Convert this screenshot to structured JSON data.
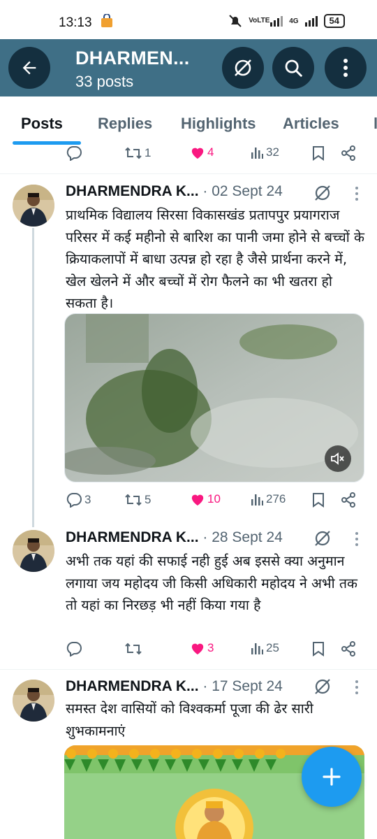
{
  "status_bar": {
    "time": "13:13",
    "network_label": "VoLTE",
    "signal_label": "4G",
    "battery": "54"
  },
  "header": {
    "title": "DHARMEN...",
    "subtitle": "33 posts"
  },
  "tabs": [
    {
      "label": "Posts",
      "active": true
    },
    {
      "label": "Replies",
      "active": false
    },
    {
      "label": "Highlights",
      "active": false
    },
    {
      "label": "Articles",
      "active": false
    }
  ],
  "top_actions": {
    "replies": "",
    "reposts": "1",
    "likes": "4",
    "views": "32"
  },
  "posts": [
    {
      "author": "DHARMENDRA K...",
      "date": "· 02 Sept 24",
      "text": "प्राथमिक विद्यालय सिरसा विकासखंड प्रतापपुर प्रयागराज परिसर में कई महीनो से बारिश का पानी जमा होने से बच्चों के क्रियाकलापों में बाधा उत्पन्न हो रहा है जैसे प्रार्थना करने में, खेल खेलने में और बच्चों में रोग फैलने का भी खतरा हो सकता है।",
      "replies": "3",
      "reposts": "5",
      "likes": "10",
      "views": "276"
    },
    {
      "author": "DHARMENDRA K...",
      "date": "· 28 Sept 24",
      "text": "अभी तक यहां की सफाई नही हुई अब इससे क्या अनुमान लगाया जय महोदय जी किसी अधिकारी महोदय ने अभी तक तो यहां का निरछड़ भी नहीं किया गया है",
      "replies": "",
      "reposts": "",
      "likes": "3",
      "views": "25"
    },
    {
      "author": "DHARMENDRA K...",
      "date": "· 17 Sept 24",
      "text": "समस्त देश वासियों को विश्वकर्मा पूजा की ढेर सारी शुभकामनाएं"
    }
  ],
  "colors": {
    "header_bg": "#3f6f86",
    "accent": "#1d9bf0",
    "like": "#f91880",
    "muted_text": "#536471"
  },
  "icons": [
    "back-arrow-icon",
    "grok-icon",
    "search-icon",
    "more-vertical-icon",
    "reply-icon",
    "repost-icon",
    "heart-icon",
    "views-icon",
    "bookmark-icon",
    "share-icon",
    "mute-icon",
    "plus-icon"
  ]
}
